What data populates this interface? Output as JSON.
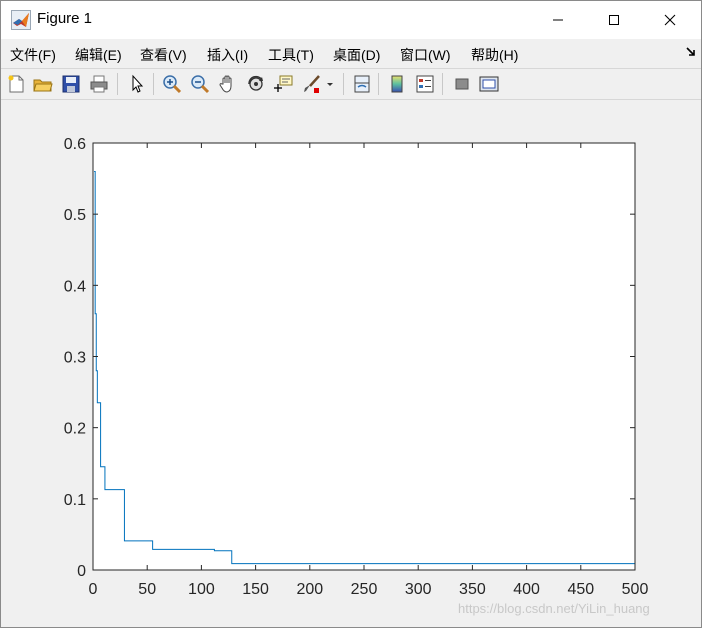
{
  "window": {
    "title": "Figure 1"
  },
  "menu": [
    {
      "label": "文件(F)",
      "name": "menu-file"
    },
    {
      "label": "编辑(E)",
      "name": "menu-edit"
    },
    {
      "label": "查看(V)",
      "name": "menu-view"
    },
    {
      "label": "插入(I)",
      "name": "menu-insert"
    },
    {
      "label": "工具(T)",
      "name": "menu-tools"
    },
    {
      "label": "桌面(D)",
      "name": "menu-desktop"
    },
    {
      "label": "窗口(W)",
      "name": "menu-window"
    },
    {
      "label": "帮助(H)",
      "name": "menu-help"
    }
  ],
  "toolbar": [
    {
      "icon": "new-figure-icon"
    },
    {
      "icon": "open-file-icon"
    },
    {
      "icon": "save-icon"
    },
    {
      "icon": "print-icon"
    },
    {
      "icon": "select-arrow-icon"
    },
    {
      "icon": "zoom-in-icon"
    },
    {
      "icon": "zoom-out-icon"
    },
    {
      "icon": "pan-hand-icon"
    },
    {
      "icon": "rotate-3d-icon"
    },
    {
      "icon": "data-cursor-icon"
    },
    {
      "icon": "brush-icon"
    },
    {
      "icon": "link-plot-icon"
    },
    {
      "icon": "colorbar-icon"
    },
    {
      "icon": "legend-icon"
    },
    {
      "icon": "hide-plot-tools-icon"
    },
    {
      "icon": "show-plot-tools-icon"
    }
  ],
  "watermark": "https://blog.csdn.net/YiLin_huang",
  "chart_data": {
    "type": "line",
    "xlim": [
      0,
      500
    ],
    "ylim": [
      0,
      0.6
    ],
    "x_ticks": [
      0,
      50,
      100,
      150,
      200,
      250,
      300,
      350,
      400,
      450,
      500
    ],
    "y_ticks": [
      "0",
      "0.1",
      "0.2",
      "0.3",
      "0.4",
      "0.5",
      "0.6"
    ],
    "y_tick_values": [
      0,
      0.1,
      0.2,
      0.3,
      0.4,
      0.5,
      0.6
    ],
    "series": [
      {
        "color": "#0072bd",
        "step": true,
        "x": [
          1,
          2,
          3,
          4,
          5,
          6,
          7,
          8,
          9,
          10,
          11,
          12,
          13,
          15,
          20,
          25,
          28,
          29,
          30,
          35,
          40,
          50,
          54,
          55,
          60,
          80,
          100,
          110,
          112,
          125,
          127,
          128,
          150,
          200,
          300,
          400,
          500
        ],
        "y": [
          0.56,
          0.36,
          0.28,
          0.235,
          0.235,
          0.235,
          0.145,
          0.145,
          0.145,
          0.145,
          0.113,
          0.113,
          0.113,
          0.113,
          0.113,
          0.113,
          0.113,
          0.041,
          0.041,
          0.041,
          0.041,
          0.041,
          0.041,
          0.029,
          0.029,
          0.029,
          0.029,
          0.029,
          0.027,
          0.027,
          0.027,
          0.009,
          0.009,
          0.009,
          0.009,
          0.009,
          0.009
        ]
      }
    ],
    "grid": false
  }
}
